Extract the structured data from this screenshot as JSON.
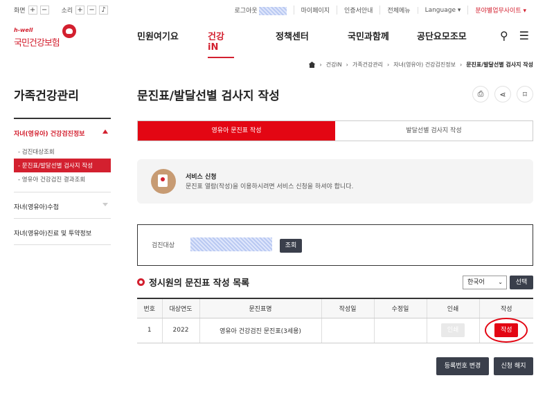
{
  "util": {
    "screen_label": "화면",
    "sound_label": "소리",
    "plus": "+",
    "minus": "−",
    "logout": "로그아웃",
    "mypage": "마이페이지",
    "cert": "인증서안내",
    "allmenu": "전체메뉴",
    "language": "Language ▾",
    "field_site": "분야별업무사이트 ▾"
  },
  "logo": {
    "tag": "h-well",
    "name": "국민건강보험"
  },
  "gnb": [
    "민원여기요",
    "건강iN",
    "정책센터",
    "국민과함께",
    "공단요모조모"
  ],
  "breadcrumb": [
    "건강iN",
    "가족건강관리",
    "자녀(영유아) 건강검진정보",
    "문진표/발달선별 검사지 작성"
  ],
  "side": {
    "title": "가족건강관리",
    "group1": "자녀(영유아) 건강검진정보",
    "subs": [
      "검진대상조회",
      "문진표/발달선별 검사지 작성",
      "영유아 건강검진 결과조회"
    ],
    "group2": "자녀(영유아)수첩",
    "group3": "자녀(영유아)진료 및 투약정보"
  },
  "main": {
    "title": "문진표/발달선별 검사지 작성",
    "tabs": [
      "영유아 문진표 작성",
      "발달선별 검사지 작성"
    ],
    "notice_title": "서비스 신청",
    "notice_desc": "문진표 열람(작성)을 이용하시려면 서비스 신청을 하셔야 합니다.",
    "search_label": "검진대상",
    "search_btn": "조회",
    "list_title": "정시원의 문진표 작성 목록",
    "lang_value": "한국어",
    "select_btn": "선택",
    "columns": [
      "번호",
      "대상연도",
      "문진표명",
      "작성일",
      "수정일",
      "인쇄",
      "작성"
    ],
    "row": {
      "no": "1",
      "year": "2022",
      "name": "영유아 건강검진 문진표(3세용)",
      "created": "",
      "modified": "",
      "print": "인쇄",
      "write": "작성"
    },
    "btn_change": "등록번호 변경",
    "btn_cancel": "신청 해지"
  }
}
